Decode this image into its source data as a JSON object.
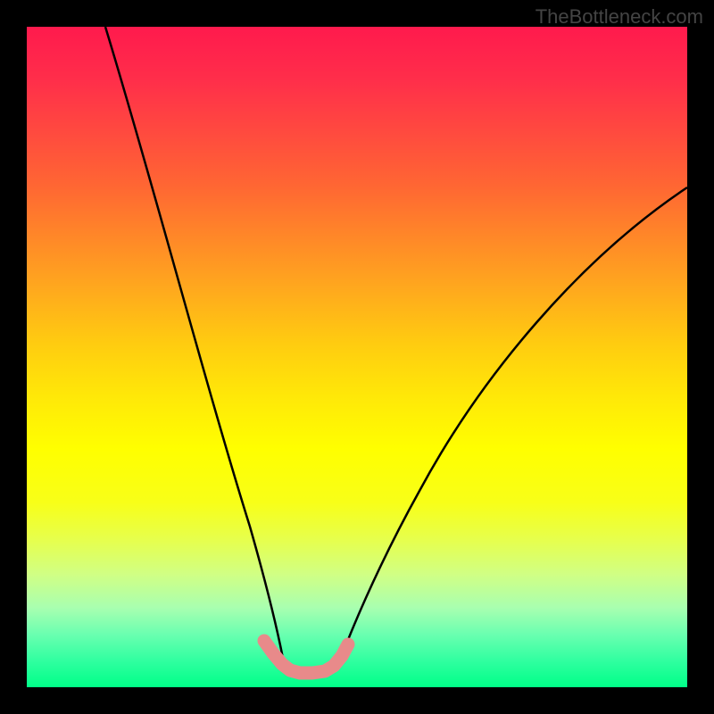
{
  "watermark": "TheBottleneck.com",
  "chart_data": {
    "type": "line",
    "title": "",
    "xlabel": "",
    "ylabel": "",
    "xlim": [
      0,
      100
    ],
    "ylim": [
      0,
      100
    ],
    "series": [
      {
        "name": "left-curve",
        "x": [
          12,
          15,
          18,
          21,
          24,
          27,
          30,
          32,
          34,
          36,
          37.5,
          39
        ],
        "values": [
          100,
          88,
          76,
          62,
          48,
          36,
          25,
          17,
          11,
          7,
          4.5,
          3
        ]
      },
      {
        "name": "right-curve",
        "x": [
          47,
          50,
          54,
          58,
          63,
          69,
          76,
          84,
          92,
          100
        ],
        "values": [
          3,
          6,
          12,
          19,
          27,
          36,
          46,
          57,
          67,
          76
        ]
      },
      {
        "name": "bottom-highlight",
        "stroke": "#e88a8a",
        "stroke_width": 12,
        "x": [
          36,
          37.5,
          39,
          40.5,
          42,
          44,
          46,
          47.5,
          49
        ],
        "values": [
          7,
          4.5,
          3,
          2.4,
          2.2,
          2.2,
          2.6,
          3.3,
          5
        ]
      }
    ],
    "annotations": []
  }
}
